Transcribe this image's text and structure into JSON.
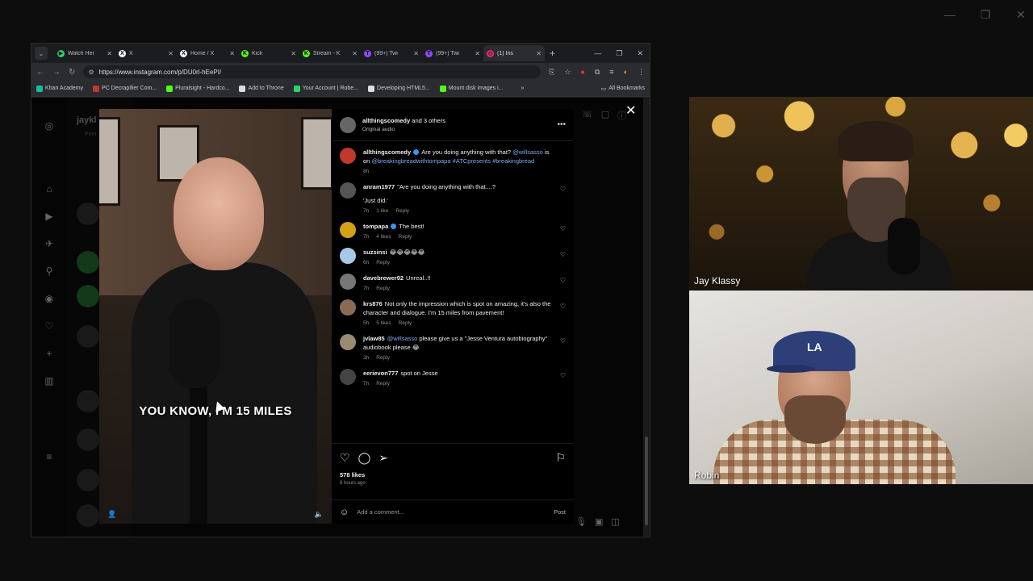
{
  "browser": {
    "tabs": [
      {
        "title": "Watch Her",
        "color": "#2bd46b",
        "glyph": "▶",
        "active": false
      },
      {
        "title": "X",
        "color": "#ffffff",
        "glyph": "X",
        "active": false
      },
      {
        "title": "Home / X",
        "color": "#ffffff",
        "glyph": "X",
        "active": false
      },
      {
        "title": "Kick",
        "color": "#53fc18",
        "glyph": "K",
        "active": false
      },
      {
        "title": "Stream - K",
        "color": "#53fc18",
        "glyph": "K",
        "active": false
      },
      {
        "title": "(99+) Twi",
        "color": "#9147ff",
        "glyph": "T",
        "active": false
      },
      {
        "title": "(99+) Twi",
        "color": "#9147ff",
        "glyph": "T",
        "active": false
      },
      {
        "title": "(1) Ins",
        "color": "#e1306c",
        "glyph": "◎",
        "active": true
      }
    ],
    "url": "https://www.instagram.com/p/DU0rl-hEePI/",
    "bookmarks": [
      {
        "label": "Khan Academy",
        "color": "#14bf96"
      },
      {
        "label": "PC Decrapifier Com...",
        "color": "#c0392b"
      },
      {
        "label": "Pluralsight - Hardco...",
        "color": "#53fc18"
      },
      {
        "label": "Add to Throne",
        "color": "#dddddd"
      },
      {
        "label": "Your Account | Robe...",
        "color": "#2bd46b"
      },
      {
        "label": "Developing HTML5...",
        "color": "#dddddd"
      },
      {
        "label": "Mount disk images i...",
        "color": "#53fc18"
      }
    ],
    "all_bookmarks": "All Bookmarks"
  },
  "ig": {
    "profile_name": "jaykl",
    "profile_sub": "Prim",
    "video_caption": "YOU KNOW, I'M 15 MILES",
    "post_header": {
      "user": "allthingscomedy",
      "and_others": "and 3 others",
      "sub": "Original audio"
    },
    "comments": [
      {
        "user": "allthingscomedy",
        "verified": true,
        "segments": [
          {
            "t": "Are you doing anything with that? ",
            "link": false
          },
          {
            "t": "@willsasso",
            "link": true
          },
          {
            "t": " is on ",
            "link": false
          },
          {
            "t": "@breakingbreadwithtompapa #ATCpresents #breakingbread",
            "link": true
          }
        ],
        "time": "8h",
        "likes": "",
        "reply": "",
        "avatar": "#c0392b"
      },
      {
        "user": "anram1977",
        "verified": false,
        "segments": [
          {
            "t": "\"Are you doing anything with that....?",
            "link": false
          }
        ],
        "line2": "'Just did.'",
        "time": "7h",
        "likes": "1 like",
        "reply": "Reply",
        "avatar": "#555555"
      },
      {
        "user": "tompapa",
        "verified": true,
        "segments": [
          {
            "t": "The best!",
            "link": false
          }
        ],
        "time": "7h",
        "likes": "4 likes",
        "reply": "Reply",
        "avatar": "#d4a017"
      },
      {
        "user": "suzsinsi",
        "verified": false,
        "segments": [
          {
            "t": "😂😂😂😂😂",
            "link": false
          }
        ],
        "time": "6h",
        "likes": "",
        "reply": "Reply",
        "avatar": "#a8c8e8"
      },
      {
        "user": "davebrewer92",
        "verified": false,
        "segments": [
          {
            "t": "Unreal..!!",
            "link": false
          }
        ],
        "time": "7h",
        "likes": "",
        "reply": "Reply",
        "avatar": "#777777"
      },
      {
        "user": "krs876",
        "verified": false,
        "segments": [
          {
            "t": "Not only the impression which is spot on amazing, it's also the character and dialogue. I'm 15 miles from pavement!",
            "link": false
          }
        ],
        "time": "5h",
        "likes": "5 likes",
        "reply": "Reply",
        "avatar": "#8a6a55"
      },
      {
        "user": "jvlaw85",
        "verified": false,
        "segments": [
          {
            "t": "@willsasso",
            "link": true
          },
          {
            "t": " please give us a \"Jesse Ventura autobiography\" audiobook please 😂",
            "link": false
          }
        ],
        "time": "3h",
        "likes": "",
        "reply": "Reply",
        "avatar": "#9a8a70"
      },
      {
        "user": "eerievon777",
        "verified": false,
        "segments": [
          {
            "t": "spot on Jesse",
            "link": false
          }
        ],
        "time": "7h",
        "likes": "",
        "reply": "Reply",
        "avatar": "#444444"
      }
    ],
    "likes_count": "578 likes",
    "posted_ago": "8 hours ago",
    "add_comment_placeholder": "Add a comment...",
    "post_label": "Post"
  },
  "webcams": [
    {
      "name": "Jay Klassy"
    },
    {
      "name": "Robin",
      "cap_logo": "LA"
    }
  ],
  "colors": {
    "accent": "#3897f0",
    "link": "#7ea8f0"
  }
}
